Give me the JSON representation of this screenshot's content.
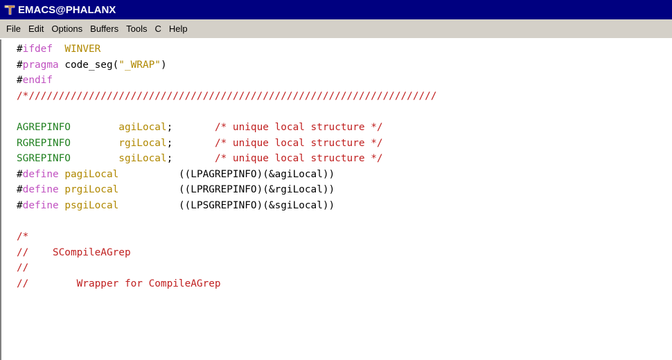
{
  "window": {
    "title": "EMACS@PHALANX"
  },
  "menu": [
    "File",
    "Edit",
    "Options",
    "Buffers",
    "Tools",
    "C",
    "Help"
  ],
  "colors": {
    "titlebar_bg": "#000080",
    "menubar_bg": "#d4d0c8",
    "preprocessor_keyword": "#c050c0",
    "string_or_variable": "#b08800",
    "type": "#208020",
    "comment": "#c02020"
  },
  "code": {
    "l1": {
      "hash": "#",
      "kw": "ifdef",
      "rest": "  WINVER"
    },
    "l2": {
      "hash": "#",
      "kw": "pragma",
      "mid": " code_seg(",
      "str": "\"_WRAP\"",
      "end": ")"
    },
    "l3": {
      "hash": "#",
      "kw": "endif"
    },
    "l4": {
      "comment": "/*////////////////////////////////////////////////////////////////////"
    },
    "l5": {},
    "l6": {
      "type": "AGREPINFO",
      "sp1": "        ",
      "var": "agiLocal",
      "semi": ";",
      "sp2": "       ",
      "comment": "/* unique local structure */"
    },
    "l7": {
      "type": "RGREPINFO",
      "sp1": "        ",
      "var": "rgiLocal",
      "semi": ";",
      "sp2": "       ",
      "comment": "/* unique local structure */"
    },
    "l8": {
      "type": "SGREPINFO",
      "sp1": "        ",
      "var": "sgiLocal",
      "semi": ";",
      "sp2": "       ",
      "comment": "/* unique local structure */"
    },
    "l9": {
      "hash": "#",
      "kw": "define",
      "sp": " ",
      "var": "pagiLocal",
      "rest": "          ((LPAGREPINFO)(&agiLocal))"
    },
    "l10": {
      "hash": "#",
      "kw": "define",
      "sp": " ",
      "var": "prgiLocal",
      "rest": "          ((LPRGREPINFO)(&rgiLocal))"
    },
    "l11": {
      "hash": "#",
      "kw": "define",
      "sp": " ",
      "var": "psgiLocal",
      "rest": "          ((LPSGREPINFO)(&sgiLocal))"
    },
    "l12": {},
    "l13": {
      "comment": "/*"
    },
    "l14": {
      "comment": "//    SCompileAGrep"
    },
    "l15": {
      "comment": "//"
    },
    "l16": {
      "comment": "//        Wrapper for CompileAGrep"
    }
  }
}
